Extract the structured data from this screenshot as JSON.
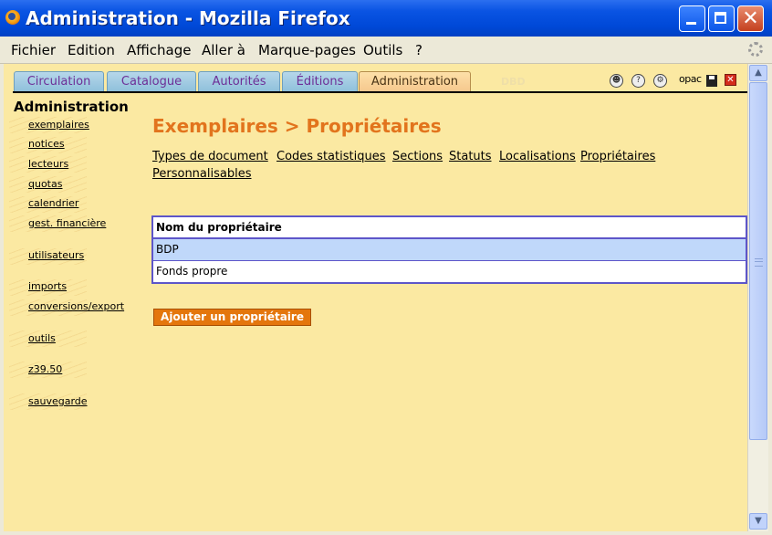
{
  "window": {
    "title": "Administration - Mozilla Firefox"
  },
  "menubar": [
    "Fichier",
    "Edition",
    "Affichage",
    "Aller à",
    "Marque-pages",
    "Outils",
    "?"
  ],
  "tabs": [
    "Circulation",
    "Catalogue",
    "Autorités",
    "Éditions",
    "Administration"
  ],
  "tab_ghost": "DBD",
  "top_icons": {
    "opac_label": "opac"
  },
  "sidebar": {
    "title": "Administration",
    "items": [
      "exemplaires",
      "notices",
      "lecteurs",
      "quotas",
      "calendrier",
      "gest. financière",
      "utilisateurs",
      "imports",
      "conversions/export",
      "outils",
      "z39.50",
      "sauvegarde"
    ]
  },
  "main": {
    "title": "Exemplaires > Propriétaires",
    "sublinks": [
      "Types de document",
      "Codes statistiques",
      "Sections",
      "Statuts",
      "Localisations",
      "Propriétaires",
      "Personnalisables"
    ],
    "table": {
      "header": "Nom du propriétaire",
      "rows": [
        "BDP",
        "Fonds propre"
      ]
    },
    "add_button": "Ajouter un propriétaire"
  },
  "colors": {
    "title_bar": "#0a54e3",
    "content_bg": "#fbe9a2",
    "page_title": "#e2741d",
    "table_border": "#5d56c9",
    "row_highlight": "#c0d8fa",
    "add_button": "#e4760c"
  }
}
